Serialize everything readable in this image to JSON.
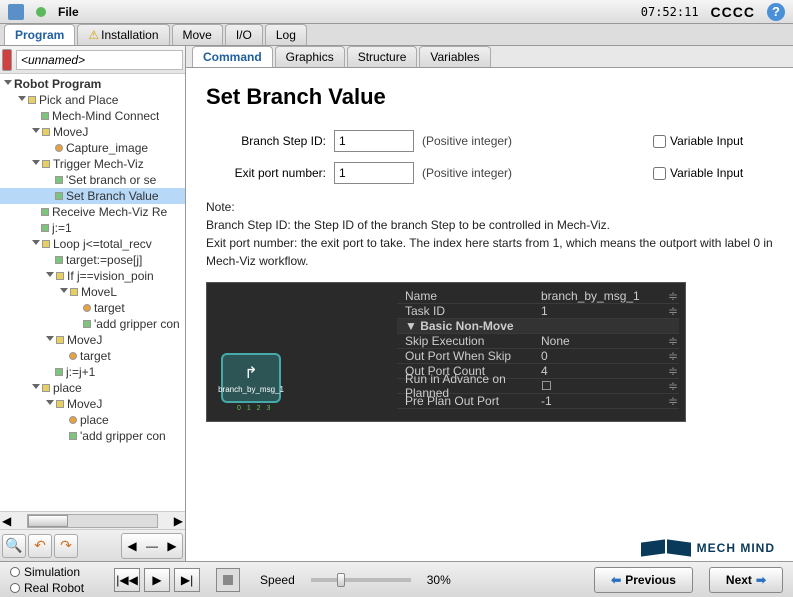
{
  "toolbar": {
    "file": "File",
    "time": "07:52:11",
    "cccc": "CCCC"
  },
  "main_tabs": [
    "Program",
    "Installation",
    "Move",
    "I/O",
    "Log"
  ],
  "program_name": "<unnamed>",
  "tree": [
    {
      "d": 0,
      "i": "tri.open",
      "c": "",
      "t": "Robot Program",
      "b": true
    },
    {
      "d": 1,
      "i": "tri.open",
      "c": "ni-yellow",
      "t": "Pick and Place"
    },
    {
      "d": 2,
      "i": "",
      "c": "ni-green",
      "t": "Mech-Mind Connect"
    },
    {
      "d": 2,
      "i": "tri.open",
      "c": "ni-yellow",
      "t": "MoveJ"
    },
    {
      "d": 3,
      "i": "",
      "c": "ni-orange",
      "t": "Capture_image"
    },
    {
      "d": 2,
      "i": "tri.open",
      "c": "ni-yellow",
      "t": "Trigger Mech-Viz"
    },
    {
      "d": 3,
      "i": "",
      "c": "ni-green",
      "t": "'Set branch or se"
    },
    {
      "d": 3,
      "i": "",
      "c": "ni-green",
      "t": "Set Branch Value",
      "sel": true
    },
    {
      "d": 2,
      "i": "",
      "c": "ni-green",
      "t": "Receive Mech-Viz Re"
    },
    {
      "d": 2,
      "i": "",
      "c": "ni-green",
      "t": "j:=1"
    },
    {
      "d": 2,
      "i": "tri.open",
      "c": "ni-yellow",
      "t": "Loop j<=total_recv"
    },
    {
      "d": 3,
      "i": "",
      "c": "ni-green",
      "t": "target:=pose[j]"
    },
    {
      "d": 3,
      "i": "tri.open",
      "c": "ni-yellow",
      "t": "If j==vision_poin"
    },
    {
      "d": 4,
      "i": "tri.open",
      "c": "ni-yellow",
      "t": "MoveL"
    },
    {
      "d": 5,
      "i": "",
      "c": "ni-orange",
      "t": "target"
    },
    {
      "d": 5,
      "i": "",
      "c": "ni-green",
      "t": "'add gripper con"
    },
    {
      "d": 3,
      "i": "tri.open",
      "c": "ni-yellow",
      "t": "MoveJ"
    },
    {
      "d": 4,
      "i": "",
      "c": "ni-orange",
      "t": "target"
    },
    {
      "d": 3,
      "i": "",
      "c": "ni-green",
      "t": "j:=j+1"
    },
    {
      "d": 2,
      "i": "tri.open",
      "c": "ni-yellow",
      "t": "place"
    },
    {
      "d": 3,
      "i": "tri.open",
      "c": "ni-yellow",
      "t": "MoveJ"
    },
    {
      "d": 4,
      "i": "",
      "c": "ni-orange",
      "t": "place"
    },
    {
      "d": 4,
      "i": "",
      "c": "ni-green",
      "t": "'add gripper con"
    }
  ],
  "sub_tabs": [
    "Command",
    "Graphics",
    "Structure",
    "Variables"
  ],
  "cmd": {
    "title": "Set Branch Value",
    "row1_label": "Branch Step ID:",
    "row1_val": "1",
    "row1_hint": "(Positive integer)",
    "row1_var": "Variable Input",
    "row2_label": "Exit port number:",
    "row2_val": "1",
    "row2_hint": "(Positive integer)",
    "row2_var": "Variable Input",
    "note": "Note:\nBranch Step ID: the Step ID of the branch Step to be controlled in Mech-Viz.\nExit port number: the exit port to take. The index here starts from 1, which means the outport with label 0 in Mech-Viz workflow."
  },
  "viz": {
    "node_label": "branch_by_msg_1",
    "rows": [
      {
        "k": "Name",
        "v": "branch_by_msg_1"
      },
      {
        "k": "Task ID",
        "v": "1"
      },
      {
        "k": "Basic Non-Move",
        "v": "",
        "hdr": true
      },
      {
        "k": "Skip Execution",
        "v": "None"
      },
      {
        "k": "Out Port When Skip",
        "v": "0"
      },
      {
        "k": "Out Port Count",
        "v": "4"
      },
      {
        "k": "Run in Advance on Planned",
        "v": "☐"
      },
      {
        "k": "Pre Plan Out Port",
        "v": "-1"
      }
    ]
  },
  "logo_text": "MECH MIND",
  "footer": {
    "sim": "Simulation",
    "real": "Real Robot",
    "speed_label": "Speed",
    "speed_val": "30%",
    "prev": "Previous",
    "next": "Next"
  }
}
